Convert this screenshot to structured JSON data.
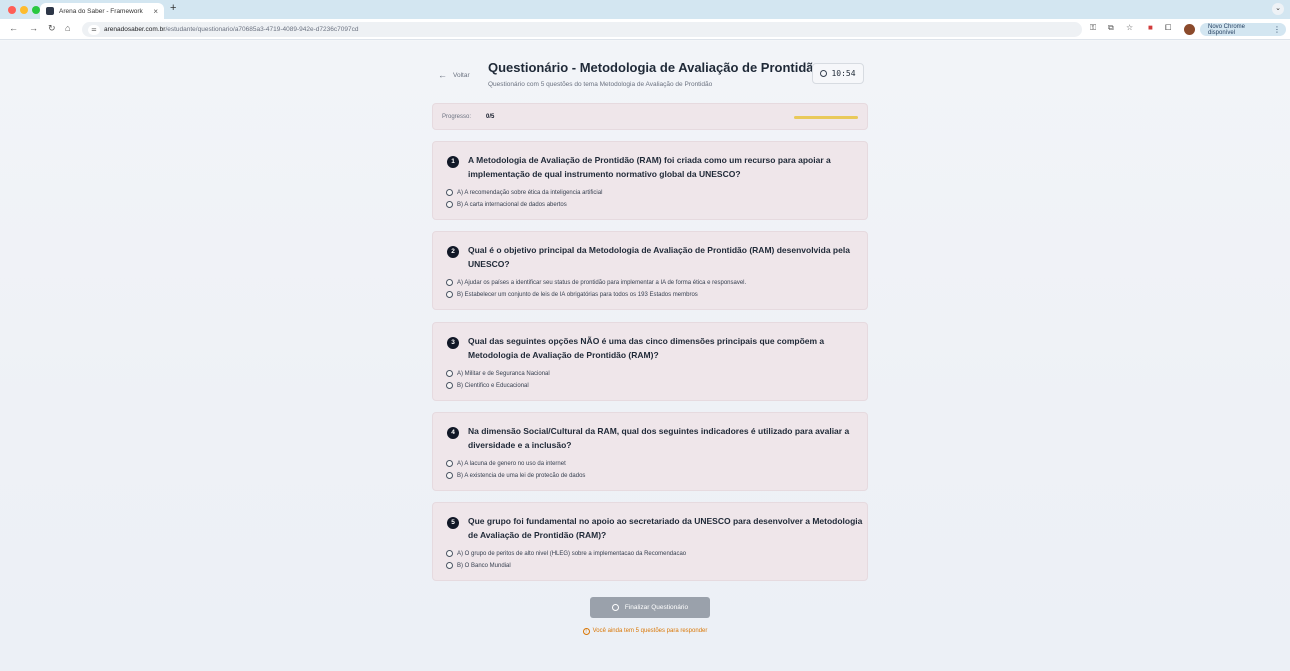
{
  "browser": {
    "tab_title": "Arena do Saber - Framework",
    "tab_close": "×",
    "new_tab": "+",
    "url_host": "arenadosaber.com.br",
    "url_path": "/estudante/questionario/a70685a3-4719-4089-942e-d7236c7097cd",
    "update_pill": "Novo Chrome disponível",
    "icons": [
      "back-icon",
      "forward-icon",
      "reload-icon",
      "home-icon",
      "site-info-icon",
      "password-key-icon",
      "translate-icon",
      "bookmark-star-icon",
      "extension-icon",
      "puzzle-icon",
      "profile-avatar",
      "menu-icon"
    ]
  },
  "header": {
    "back_label": "Voltar",
    "title": "Questionário - Metodologia de Avaliação de Prontidão",
    "subtitle": "Questionário com 5 questões do tema Metodologia de Avaliação de Prontidão",
    "timer": "10:54"
  },
  "progress": {
    "label": "Progresso:",
    "value": "0/5",
    "fraction": 0
  },
  "questions": [
    {
      "number": "1",
      "text": "A Metodologia de Avaliação de Prontidão (RAM) foi criada como um recurso para apoiar a implementação de qual instrumento normativo global da UNESCO?",
      "options": [
        "A) A recomendação sobre ética da inteligencia artificial",
        "B) A carta internacional de dados abertos"
      ]
    },
    {
      "number": "2",
      "text": "Qual é o objetivo principal da Metodologia de Avaliação de Prontidão (RAM) desenvolvida pela UNESCO?",
      "options": [
        "A) Ajudar os países a identificar seu status de prontidão para implementar a IA de forma ética e responsavel.",
        "B) Estabelecer um conjunto de leis de IA obrigatórias para todos os 193 Estados membros"
      ]
    },
    {
      "number": "3",
      "text": "Qual das seguintes opções NÃO é uma das cinco dimensões principais que compõem a Metodologia de Avaliação de Prontidão (RAM)?",
      "options": [
        "A) Militar e de Seguranca Nacional",
        "B) Cientifico e Educacional"
      ]
    },
    {
      "number": "4",
      "text": "Na dimensão Social/Cultural da RAM, qual dos seguintes indicadores é utilizado para avaliar a diversidade e a inclusão?",
      "options": [
        "A) A lacuna de genero no uso da internet",
        "B) A existencia de uma lei de protecão de dados"
      ]
    },
    {
      "number": "5",
      "text": "Que grupo foi fundamental no apoio ao secretariado da UNESCO para desenvolver a Metodologia de Avaliação de Prontidão (RAM)?",
      "options": [
        "A) O grupo de peritos de alto nivel (HLEG) sobre a implementacao da Recomendacao",
        "B) O Banco Mundial"
      ]
    }
  ],
  "footer": {
    "finish_label": "Finalizar Questionário",
    "warning": "Você ainda tem 5 questões para responder"
  },
  "colors": {
    "card_bg": "#efe6ea",
    "progress_track": "#e9c95a",
    "button_disabled": "#9aa1ab",
    "warning": "#d97706"
  }
}
